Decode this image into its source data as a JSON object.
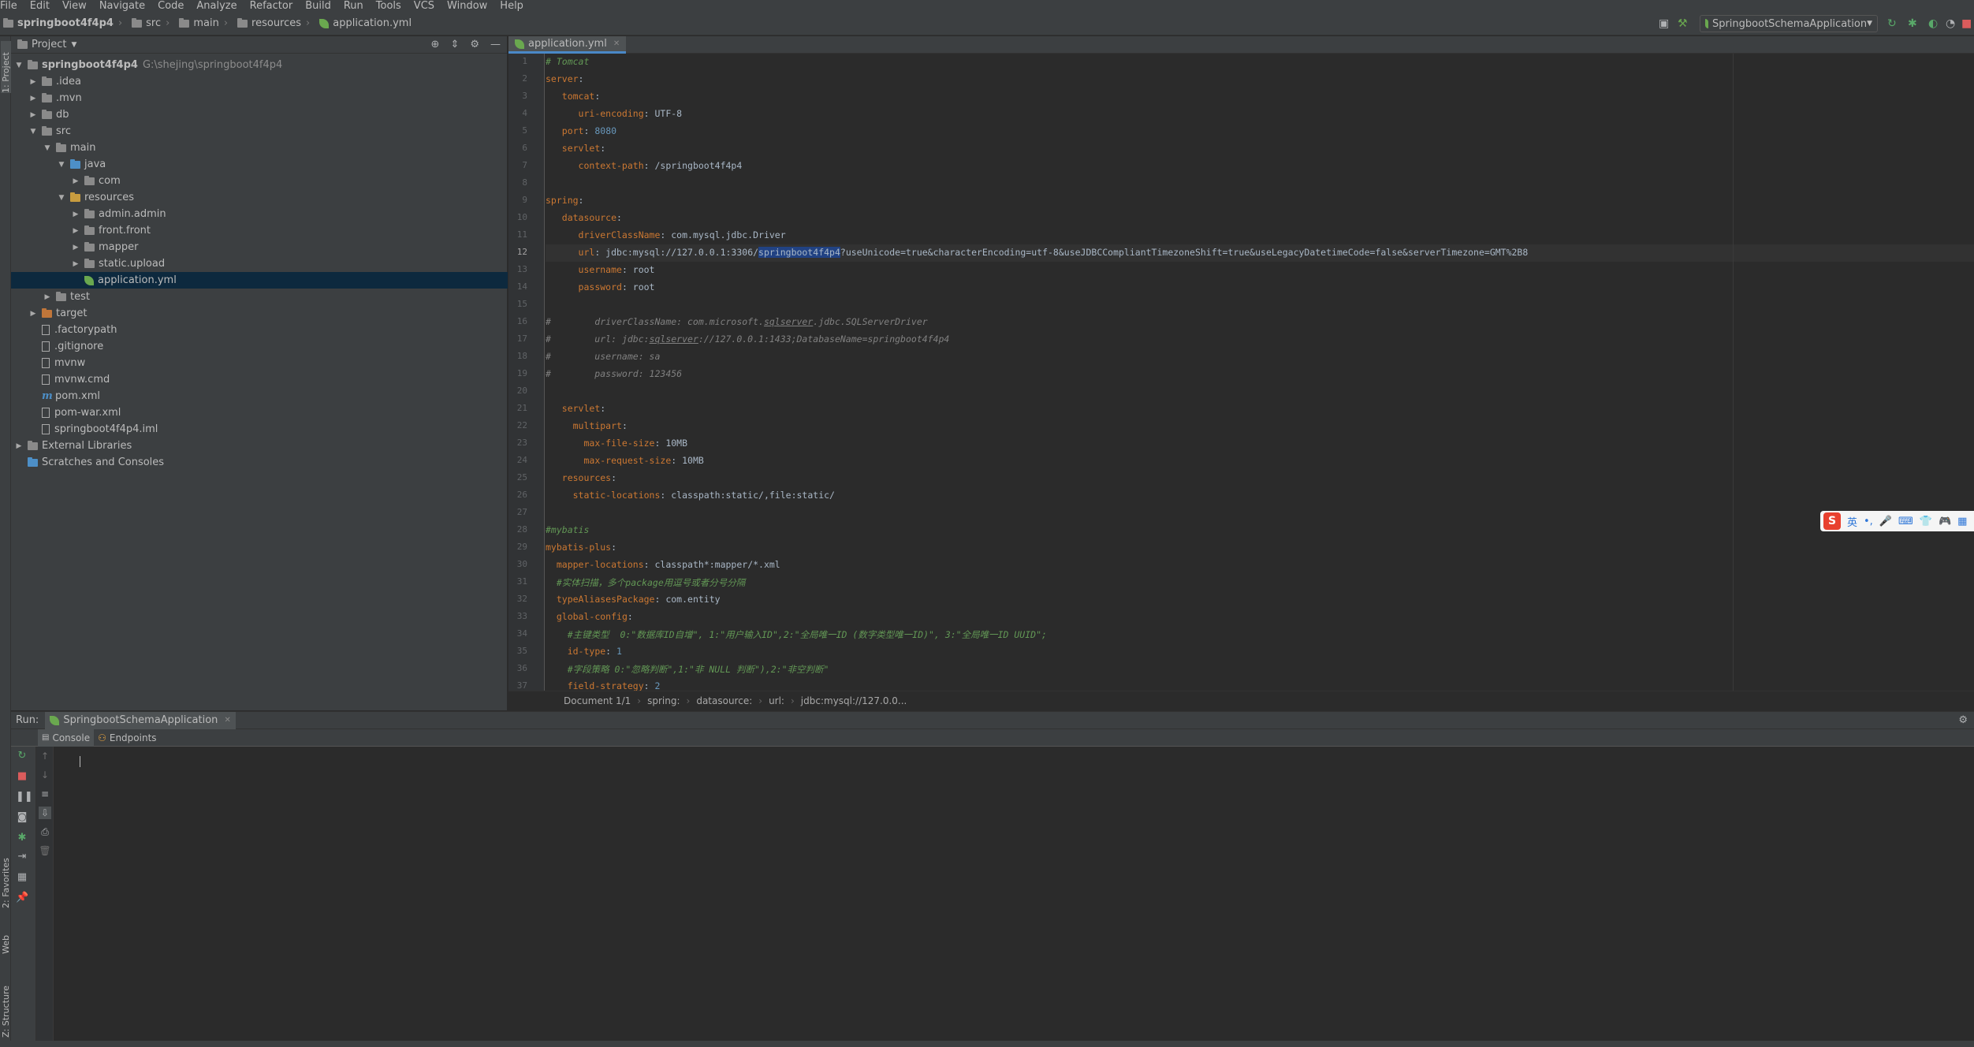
{
  "menu": [
    "File",
    "Edit",
    "View",
    "Navigate",
    "Code",
    "Analyze",
    "Refactor",
    "Build",
    "Run",
    "Tools",
    "VCS",
    "Window",
    "Help"
  ],
  "breadcrumb": [
    "springboot4f4p4",
    "src",
    "main",
    "resources",
    "application.yml"
  ],
  "run_config": "SpringbootSchemaApplication",
  "left_stripe": [
    "1: Project",
    "2: Favorites",
    "Web",
    "Z: Structure"
  ],
  "project": {
    "header": "Project",
    "tree": [
      {
        "label": "springboot4f4p4",
        "sub": "G:\\shejing\\springboot4f4p4",
        "depth": 0,
        "expanded": true,
        "icon": "folder-icon",
        "bold": true
      },
      {
        "label": ".idea",
        "depth": 1,
        "expanded": false,
        "icon": "folder-icon"
      },
      {
        "label": ".mvn",
        "depth": 1,
        "expanded": false,
        "icon": "folder-icon"
      },
      {
        "label": "db",
        "depth": 1,
        "expanded": false,
        "icon": "folder-icon"
      },
      {
        "label": "src",
        "depth": 1,
        "expanded": true,
        "icon": "folder-icon"
      },
      {
        "label": "main",
        "depth": 2,
        "expanded": true,
        "icon": "folder-icon"
      },
      {
        "label": "java",
        "depth": 3,
        "expanded": true,
        "icon": "source-folder-icon"
      },
      {
        "label": "com",
        "depth": 4,
        "expanded": false,
        "icon": "package-icon"
      },
      {
        "label": "resources",
        "depth": 3,
        "expanded": true,
        "icon": "resources-folder-icon"
      },
      {
        "label": "admin.admin",
        "depth": 4,
        "expanded": false,
        "icon": "folder-icon"
      },
      {
        "label": "front.front",
        "depth": 4,
        "expanded": false,
        "icon": "folder-icon"
      },
      {
        "label": "mapper",
        "depth": 4,
        "expanded": false,
        "icon": "folder-icon"
      },
      {
        "label": "static.upload",
        "depth": 4,
        "expanded": false,
        "icon": "folder-icon"
      },
      {
        "label": "application.yml",
        "depth": 4,
        "leaf": true,
        "icon": "spring-leaf-icon",
        "selected": true
      },
      {
        "label": "test",
        "depth": 2,
        "expanded": false,
        "icon": "folder-icon"
      },
      {
        "label": "target",
        "depth": 1,
        "expanded": false,
        "icon": "excluded-folder-icon"
      },
      {
        "label": ".factorypath",
        "depth": 1,
        "leaf": true,
        "icon": "file-icon"
      },
      {
        "label": ".gitignore",
        "depth": 1,
        "leaf": true,
        "icon": "file-icon"
      },
      {
        "label": "mvnw",
        "depth": 1,
        "leaf": true,
        "icon": "file-icon"
      },
      {
        "label": "mvnw.cmd",
        "depth": 1,
        "leaf": true,
        "icon": "file-icon"
      },
      {
        "label": "pom.xml",
        "depth": 1,
        "leaf": true,
        "icon": "maven-icon"
      },
      {
        "label": "pom-war.xml",
        "depth": 1,
        "leaf": true,
        "icon": "xml-file-icon"
      },
      {
        "label": "springboot4f4p4.iml",
        "depth": 1,
        "leaf": true,
        "icon": "file-icon"
      },
      {
        "label": "External Libraries",
        "depth": 0,
        "expanded": false,
        "icon": "library-icon"
      },
      {
        "label": "Scratches and Consoles",
        "depth": 0,
        "leaf": true,
        "icon": "scratches-icon"
      }
    ]
  },
  "editor": {
    "tab": "application.yml",
    "current_line": 12,
    "lines": [
      [
        [
          "c",
          "# Tomcat"
        ]
      ],
      [
        [
          "k",
          "server"
        ],
        [
          "t",
          ":"
        ]
      ],
      [
        [
          "t",
          "   "
        ],
        [
          "k",
          "tomcat"
        ],
        [
          "t",
          ":"
        ]
      ],
      [
        [
          "t",
          "      "
        ],
        [
          "k",
          "uri-encoding"
        ],
        [
          "t",
          ": UTF-8"
        ]
      ],
      [
        [
          "t",
          "   "
        ],
        [
          "k",
          "port"
        ],
        [
          "t",
          ": "
        ],
        [
          "n",
          "8080"
        ]
      ],
      [
        [
          "t",
          "   "
        ],
        [
          "k",
          "servlet"
        ],
        [
          "t",
          ":"
        ]
      ],
      [
        [
          "t",
          "      "
        ],
        [
          "k",
          "context-path"
        ],
        [
          "t",
          ": /springboot4f4p4"
        ]
      ],
      [],
      [
        [
          "k",
          "spring"
        ],
        [
          "t",
          ":"
        ]
      ],
      [
        [
          "t",
          "   "
        ],
        [
          "k",
          "datasource"
        ],
        [
          "t",
          ":"
        ]
      ],
      [
        [
          "t",
          "      "
        ],
        [
          "k",
          "driverClassName"
        ],
        [
          "t",
          ": com.mysql.jdbc.Driver"
        ]
      ],
      [
        [
          "t",
          "      "
        ],
        [
          "k",
          "url"
        ],
        [
          "t",
          ": jdbc:mysql://127.0.0.1:3306/"
        ],
        [
          "h",
          "springboot4f4p4"
        ],
        [
          "t",
          "?useUnicode=true&characterEncoding=utf-8&useJDBCCompliantTimezoneShift=true&useLegacyDatetimeCode=false&serverTimezone=GMT%2B8"
        ]
      ],
      [
        [
          "t",
          "      "
        ],
        [
          "k",
          "username"
        ],
        [
          "t",
          ": root"
        ]
      ],
      [
        [
          "t",
          "      "
        ],
        [
          "k",
          "password"
        ],
        [
          "t",
          ": root"
        ]
      ],
      [],
      [
        [
          "cg",
          "#        driverClassName: com.microsoft."
        ],
        [
          "cgu",
          "sqlserver"
        ],
        [
          "cg",
          ".jdbc.SQLServerDriver"
        ]
      ],
      [
        [
          "cg",
          "#        url: jdbc:"
        ],
        [
          "cgu",
          "sqlserver"
        ],
        [
          "cg",
          "://127.0.0.1:1433;DatabaseName=springboot4f4p4"
        ]
      ],
      [
        [
          "cg",
          "#        username: sa"
        ]
      ],
      [
        [
          "cg",
          "#        password: 123456"
        ]
      ],
      [],
      [
        [
          "t",
          "   "
        ],
        [
          "k",
          "servlet"
        ],
        [
          "t",
          ":"
        ]
      ],
      [
        [
          "t",
          "     "
        ],
        [
          "k",
          "multipart"
        ],
        [
          "t",
          ":"
        ]
      ],
      [
        [
          "t",
          "       "
        ],
        [
          "k",
          "max-file-size"
        ],
        [
          "t",
          ": 10MB"
        ]
      ],
      [
        [
          "t",
          "       "
        ],
        [
          "k",
          "max-request-size"
        ],
        [
          "t",
          ": 10MB"
        ]
      ],
      [
        [
          "t",
          "   "
        ],
        [
          "k",
          "resources"
        ],
        [
          "t",
          ":"
        ]
      ],
      [
        [
          "t",
          "     "
        ],
        [
          "k",
          "static-locations"
        ],
        [
          "t",
          ": classpath:static/,file:static/"
        ]
      ],
      [],
      [
        [
          "c",
          "#mybatis"
        ]
      ],
      [
        [
          "k",
          "mybatis-plus"
        ],
        [
          "t",
          ":"
        ]
      ],
      [
        [
          "t",
          "  "
        ],
        [
          "k",
          "mapper-locations"
        ],
        [
          "t",
          ": classpath*:mapper/*.xml"
        ]
      ],
      [
        [
          "t",
          "  "
        ],
        [
          "c",
          "#实体扫描，多个package用逗号或者分号分隔"
        ]
      ],
      [
        [
          "t",
          "  "
        ],
        [
          "k",
          "typeAliasesPackage"
        ],
        [
          "t",
          ": com.entity"
        ]
      ],
      [
        [
          "t",
          "  "
        ],
        [
          "k",
          "global-config"
        ],
        [
          "t",
          ":"
        ]
      ],
      [
        [
          "t",
          "    "
        ],
        [
          "c",
          "#主键类型  0:\"数据库ID自增\", 1:\"用户输入ID\",2:\"全局唯一ID (数字类型唯一ID)\", 3:\"全局唯一ID UUID\";"
        ]
      ],
      [
        [
          "t",
          "    "
        ],
        [
          "k",
          "id-type"
        ],
        [
          "t",
          ": "
        ],
        [
          "n",
          "1"
        ]
      ],
      [
        [
          "t",
          "    "
        ],
        [
          "c",
          "#字段策略 0:\"忽略判断\",1:\"非 NULL 判断\"),2:\"非空判断\""
        ]
      ],
      [
        [
          "t",
          "    "
        ],
        [
          "k",
          "field-strategy"
        ],
        [
          "t",
          ": "
        ],
        [
          "n",
          "2"
        ]
      ]
    ],
    "breadcrumb": [
      "Document 1/1",
      "spring:",
      "datasource:",
      "url:",
      "jdbc:mysql://127.0.0..."
    ]
  },
  "ime": {
    "logo": "S",
    "lang": "英",
    "glyphs": [
      "•,",
      "🎤",
      "⌨",
      "👕",
      "🎮",
      "▦"
    ]
  },
  "run_panel": {
    "label": "Run:",
    "tab": "SpringbootSchemaApplication",
    "subtabs": [
      "Console",
      "Endpoints"
    ]
  },
  "colors": {
    "keyword": "#cc7832",
    "comment": "#629755",
    "number": "#6897bb",
    "text": "#a9b7c6",
    "selection": "#214283"
  }
}
